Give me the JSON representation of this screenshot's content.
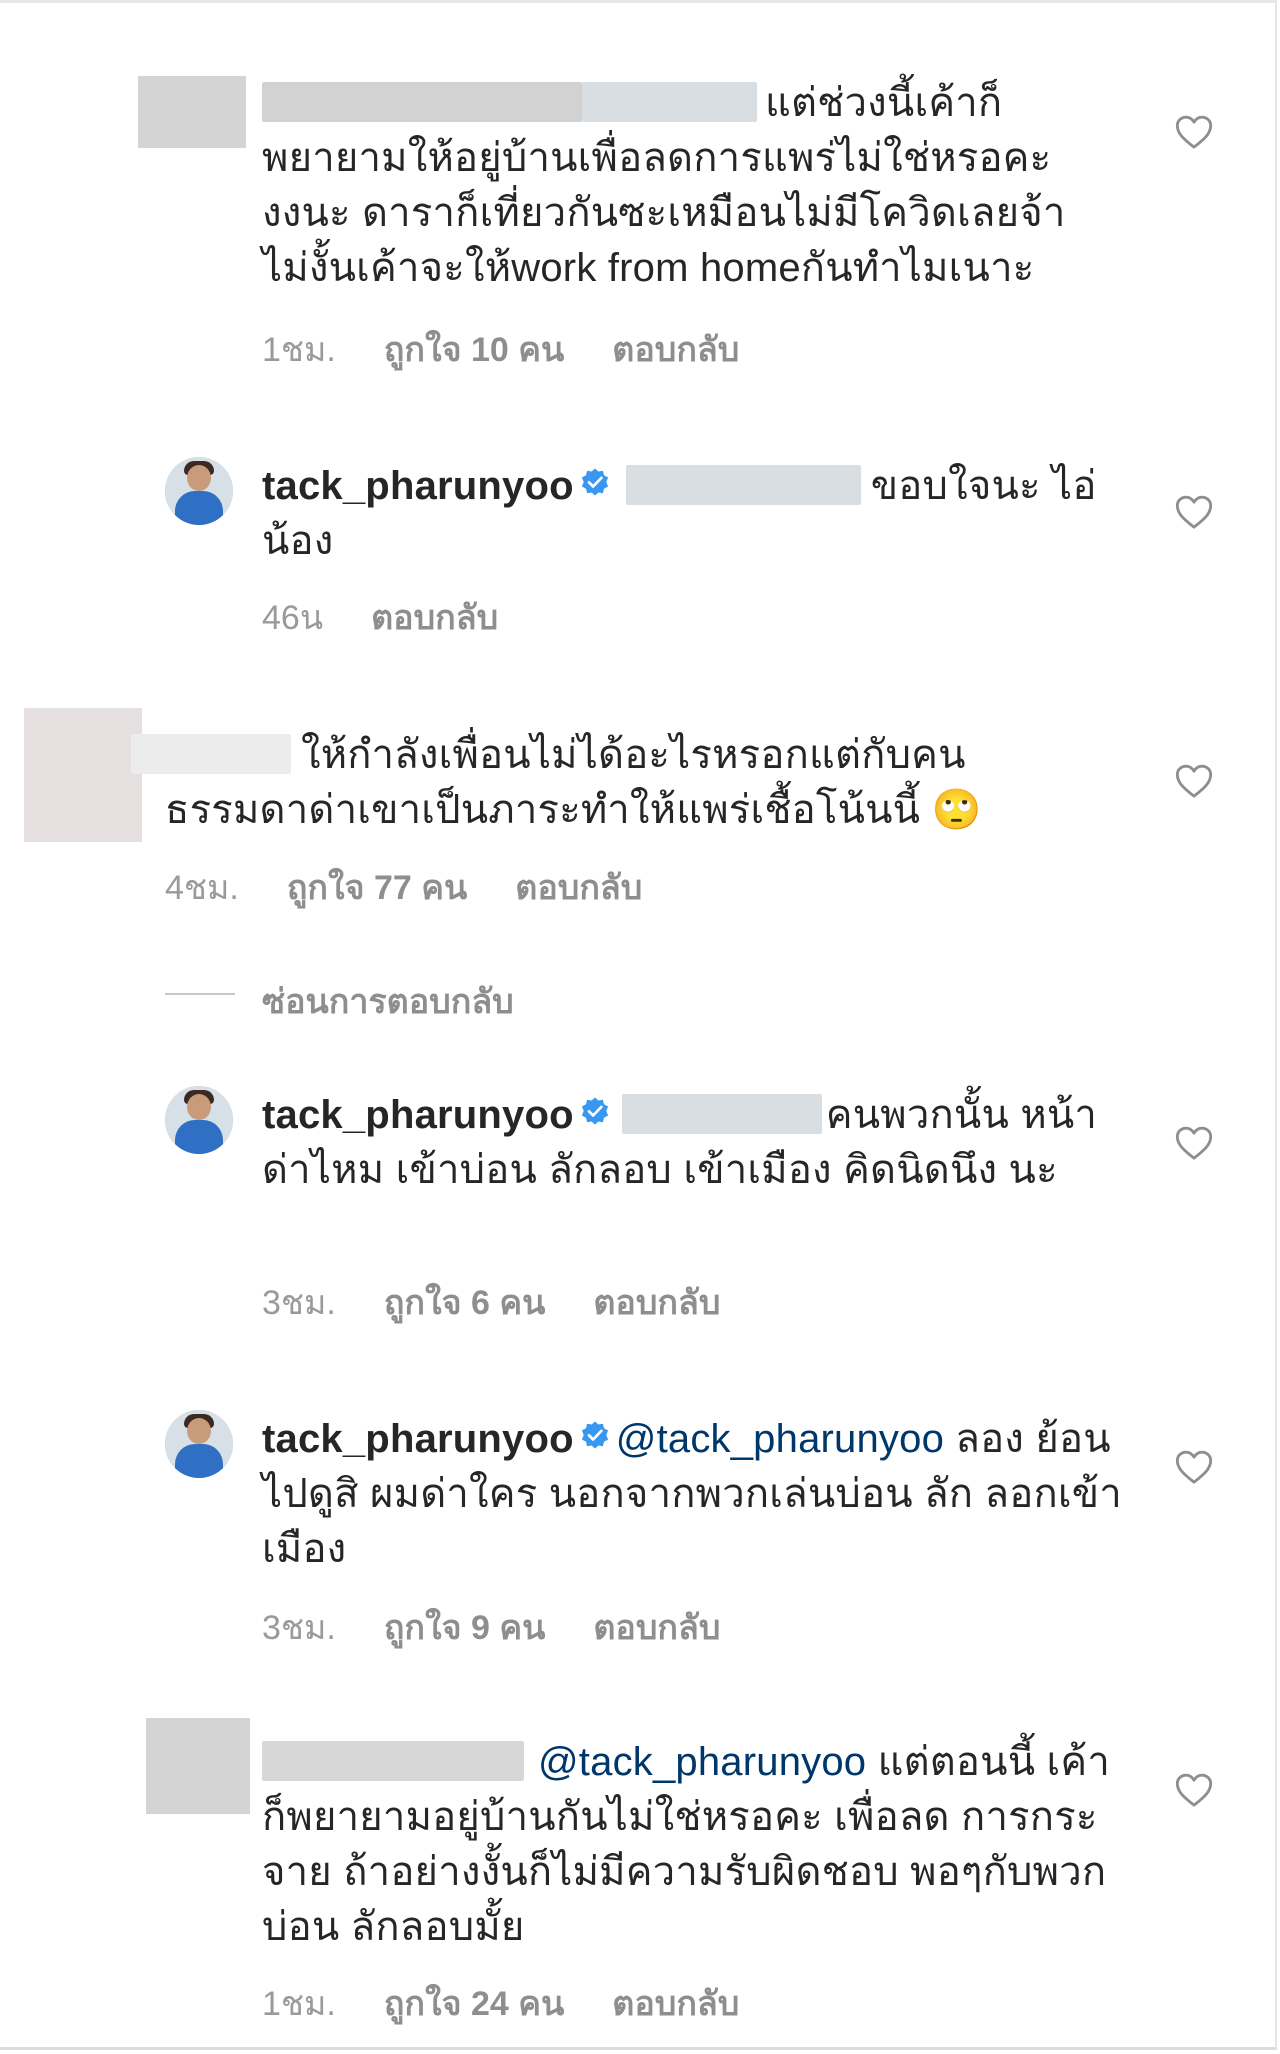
{
  "comments": [
    {
      "text": "แต่ช่วงนี้เค้าก็ พยายามให้อยู่บ้านเพื่อลดการแพร่ไม่ใช่หรอคะ งงนะ ดาราก็เที่ยวกันซะเหมือนไม่มีโควิดเลยจ้า ไม่งั้นเค้าจะให้work from homeกันทำไมเนาะ",
      "time": "1ชม.",
      "likes": "ถูกใจ 10 คน",
      "reply": "ตอบกลับ"
    },
    {
      "username": "tack_pharunyoo",
      "text": "ขอบใจนะ ไอ่น้อง",
      "time": "46น",
      "reply": "ตอบกลับ"
    },
    {
      "text": "ให้กำลังเพื่อนไม่ได้อะไรหรอกแต่กับคน ธรรมดาด่าเขาเป็นภาระทำให้แพร่เชื้อโน้นนี้",
      "emoji": "🙄",
      "time": "4ชม.",
      "likes": "ถูกใจ 77 คน",
      "reply": "ตอบกลับ"
    },
    {
      "username": "tack_pharunyoo",
      "text": "คนพวกนั้น หน้าด่าไหม เข้าบ่อน ลักลอบ เข้าเมือง คิดนิดนึง นะ",
      "time": "3ชม.",
      "likes": "ถูกใจ 6 คน",
      "reply": "ตอบกลับ"
    },
    {
      "username": "tack_pharunyoo",
      "mention": "@tack_pharunyoo",
      "text": "ลอง ย้อนไปดูสิ ผมด่าใคร นอกจากพวกเล่นบ่อน ลัก ลอกเข้าเมือง",
      "time": "3ชม.",
      "likes": "ถูกใจ 9 คน",
      "reply": "ตอบกลับ"
    },
    {
      "mention": "@tack_pharunyoo",
      "text": "แต่ตอนนี้ เค้าก็พยายามอยู่บ้านกันไม่ใช่หรอคะ เพื่อลด การกระจาย ถ้าอย่างงั้นก็ไม่มีความรับผิดชอบ พอๆกับพวกบ่อน ลักลอบมั้ย",
      "time": "1ชม.",
      "likes": "ถูกใจ 24 คน",
      "reply": "ตอบกลับ"
    }
  ],
  "hide_replies": "ซ่อนการตอบกลับ",
  "colors": {
    "verified": "#3897f0",
    "mention": "#00376b",
    "meta": "#8e8e8e"
  }
}
